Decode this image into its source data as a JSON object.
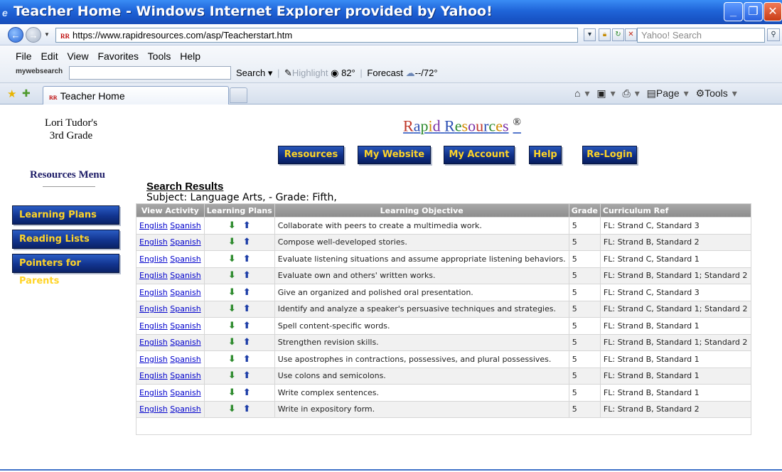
{
  "window": {
    "title": "Teacher Home - Windows Internet Explorer provided by Yahoo!",
    "minimize": "_",
    "maximize": "❐",
    "close": "✕"
  },
  "address": {
    "url": "https://www.rapidresources.com/asp/Teacherstart.htm",
    "search_placeholder": "Yahoo! Search"
  },
  "menubar": {
    "items": [
      "File",
      "Edit",
      "View",
      "Favorites",
      "Tools",
      "Help"
    ]
  },
  "toolbar": {
    "mywebsearch": "mywebsearch",
    "search_label": "Search",
    "highlight_label": "Highlight",
    "temperature": "82°",
    "forecast_label": "Forecast",
    "forecast_value": "--/72°"
  },
  "tabs": {
    "active_tab": "Teacher Home"
  },
  "commandbar": {
    "page_label": "Page",
    "tools_label": "Tools"
  },
  "header": {
    "teacher_name": "Lori Tudor's",
    "teacher_grade": "3rd Grade",
    "brand": "Rapid Resources",
    "brand_mark": "®"
  },
  "nav": {
    "resources": "Resources",
    "my_website": "My Website",
    "my_account": "My Account",
    "help": "Help",
    "relogin": "Re-Login"
  },
  "sidebar": {
    "title": "Resources Menu",
    "items": [
      "Learning Plans",
      "Reading Lists",
      "Pointers for Parents"
    ]
  },
  "results": {
    "title": "Search Results",
    "subtitle": "Subject: Language Arts, - Grade: Fifth,",
    "columns": [
      "View Activity",
      "Learning Plans",
      "Learning Objective",
      "Grade",
      "Curriculum Ref"
    ],
    "english_label": "English",
    "spanish_label": "Spanish",
    "rows": [
      {
        "objective": "Collaborate with peers to create a multimedia work.",
        "grade": "5",
        "ref": "FL: Strand C, Standard 3"
      },
      {
        "objective": "Compose well-developed stories.",
        "grade": "5",
        "ref": "FL: Strand B, Standard 2"
      },
      {
        "objective": "Evaluate listening situations and assume appropriate listening behaviors.",
        "grade": "5",
        "ref": "FL: Strand C, Standard 1"
      },
      {
        "objective": "Evaluate own and others' written works.",
        "grade": "5",
        "ref": "FL: Strand B, Standard 1; Standard 2"
      },
      {
        "objective": "Give an organized and polished oral presentation.",
        "grade": "5",
        "ref": "FL: Strand C, Standard 3"
      },
      {
        "objective": "Identify and analyze a speaker's persuasive techniques and strategies.",
        "grade": "5",
        "ref": "FL: Strand C, Standard 1; Standard 2"
      },
      {
        "objective": "Spell content-specific words.",
        "grade": "5",
        "ref": "FL: Strand B, Standard 1"
      },
      {
        "objective": "Strengthen revision skills.",
        "grade": "5",
        "ref": "FL: Strand B, Standard 1; Standard 2"
      },
      {
        "objective": "Use apostrophes in contractions, possessives, and plural possessives.",
        "grade": "5",
        "ref": "FL: Strand B, Standard 1"
      },
      {
        "objective": "Use colons and semicolons.",
        "grade": "5",
        "ref": "FL: Strand B, Standard 1"
      },
      {
        "objective": "Write complex sentences.",
        "grade": "5",
        "ref": "FL: Strand B, Standard 1"
      },
      {
        "objective": "Write in expository form.",
        "grade": "5",
        "ref": "FL: Strand B, Standard 2"
      }
    ]
  },
  "colors": {
    "titlebar": "#1f64d8",
    "nav_button": "#0f2f86",
    "nav_text": "#ffd427",
    "table_header": "#999999"
  }
}
